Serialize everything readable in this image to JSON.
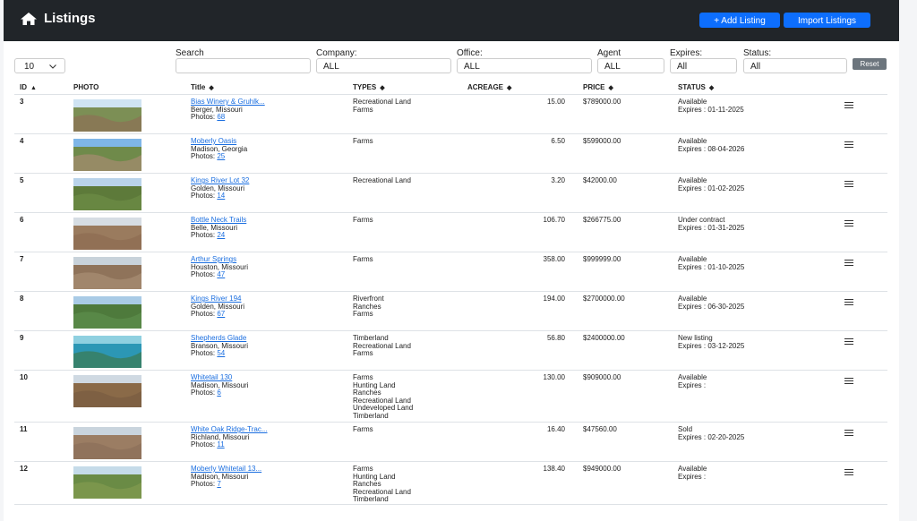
{
  "header": {
    "title": "Listings",
    "add_label": "+ Add Listing",
    "import_label": "Import Listings"
  },
  "page_size": "10",
  "filters": {
    "search_label": "Search",
    "search_value": "",
    "company_label": "Company:",
    "company_value": "ALL",
    "office_label": "Office:",
    "office_value": "ALL",
    "agent_label": "Agent",
    "agent_value": "ALL",
    "expires_label": "Expires:",
    "expires_value": "All",
    "status_label": "Status:",
    "status_value": "All",
    "reset_label": "Reset"
  },
  "columns": [
    "ID",
    "PHOTO",
    "Title",
    "TYPES",
    "ACREAGE",
    "PRICE",
    "STATUS"
  ],
  "rows": [
    {
      "id": "3",
      "title": "Bias Winery & Gruhlk...",
      "location": "Berger, Missouri",
      "photos": "68",
      "types": [
        "Recreational Land",
        "Farms"
      ],
      "acreage": "15.00",
      "price": "$789000.00",
      "status": "Available",
      "expires": "Expires : 01-11-2025",
      "thumb": [
        "#7c8f55",
        "#cfe3f2",
        "#8b7355"
      ]
    },
    {
      "id": "4",
      "title": "Moberly Oasis",
      "location": "Madison, Georgia",
      "photos": "25",
      "types": [
        "Farms"
      ],
      "acreage": "6.50",
      "price": "$599000.00",
      "status": "Available",
      "expires": "Expires : 08-04-2026",
      "thumb": [
        "#6f8a4a",
        "#7fb6e8",
        "#a08b6b"
      ]
    },
    {
      "id": "5",
      "title": "Kings River Lot 32",
      "location": "Golden, Missouri",
      "photos": "14",
      "types": [
        "Recreational Land"
      ],
      "acreage": "3.20",
      "price": "$42000.00",
      "status": "Available",
      "expires": "Expires : 01-02-2025",
      "thumb": [
        "#5d7a3a",
        "#b9d3ea",
        "#6c8b45"
      ]
    },
    {
      "id": "6",
      "title": "Bottle Neck Trails",
      "location": "Belle, Missouri",
      "photos": "24",
      "types": [
        "Farms"
      ],
      "acreage": "106.70",
      "price": "$266775.00",
      "status": "Under contract",
      "expires": "Expires : 01-31-2025",
      "thumb": [
        "#9a7b5e",
        "#d6dde3",
        "#8e6e52"
      ]
    },
    {
      "id": "7",
      "title": "Arthur Springs",
      "location": "Houston, Missouri",
      "photos": "47",
      "types": [
        "Farms"
      ],
      "acreage": "358.00",
      "price": "$999999.00",
      "status": "Available",
      "expires": "Expires : 01-10-2025",
      "thumb": [
        "#8f735a",
        "#c8d2da",
        "#a58b70"
      ]
    },
    {
      "id": "8",
      "title": "Kings River 194",
      "location": "Golden, Missouri",
      "photos": "67",
      "types": [
        "Riverfront",
        "Ranches",
        "Farms"
      ],
      "acreage": "194.00",
      "price": "$2700000.00",
      "status": "Available",
      "expires": "Expires : 06-30-2025",
      "thumb": [
        "#4e7a3c",
        "#a9cbe6",
        "#5b8c4a"
      ]
    },
    {
      "id": "9",
      "title": "Shepherds Glade",
      "location": "Branson, Missouri",
      "photos": "54",
      "types": [
        "Timberland",
        "Recreational Land",
        "Farms"
      ],
      "acreage": "56.80",
      "price": "$2400000.00",
      "status": "New listing",
      "expires": "Expires : 03-12-2025",
      "thumb": [
        "#2c97b5",
        "#8fd0e0",
        "#3a7d5c"
      ]
    },
    {
      "id": "10",
      "title": "Whitetail 130",
      "location": "Madison, Missouri",
      "photos": "6",
      "types": [
        "Farms",
        "Hunting Land",
        "Ranches",
        "Recreational Land",
        "Undeveloped Land",
        "Timberland"
      ],
      "acreage": "130.00",
      "price": "$909000.00",
      "status": "Available",
      "expires": "Expires :",
      "thumb": [
        "#8a6a48",
        "#cfd9e2",
        "#7b5e42"
      ]
    },
    {
      "id": "11",
      "title": "White Oak Ridge-Trac...",
      "location": "Richland, Missouri",
      "photos": "11",
      "types": [
        "Farms"
      ],
      "acreage": "16.40",
      "price": "$47560.00",
      "status": "Sold",
      "expires": "Expires : 02-20-2025",
      "thumb": [
        "#9b7d63",
        "#c9d4dd",
        "#8d715a"
      ]
    },
    {
      "id": "12",
      "title": "Moberly Whitetail 13...",
      "location": "Madison, Missouri",
      "photos": "7",
      "types": [
        "Farms",
        "Hunting Land",
        "Ranches",
        "Recreational Land",
        "Timberland"
      ],
      "acreage": "138.40",
      "price": "$949000.00",
      "status": "Available",
      "expires": "Expires :",
      "thumb": [
        "#6a8b45",
        "#c5dbe9",
        "#80984e"
      ]
    }
  ],
  "photos_prefix": "Photos: ",
  "icons": {
    "home": "home-icon",
    "menu": "hamburger-menu-icon",
    "sort": "sort-arrows-icon",
    "dropdown": "chevron-down-icon"
  }
}
